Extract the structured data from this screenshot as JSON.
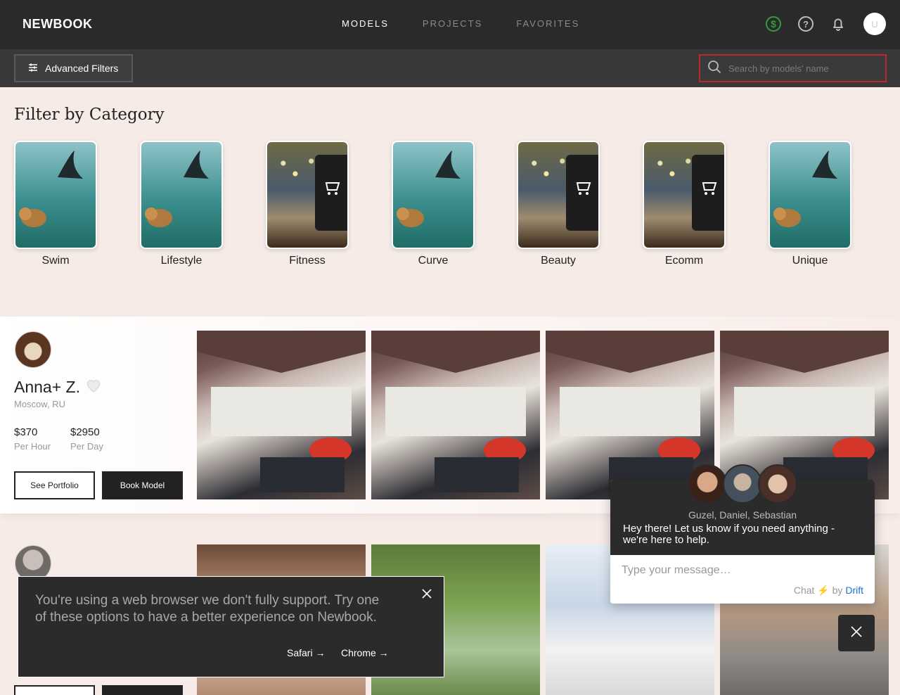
{
  "nav": {
    "logo": "NEWBOOK",
    "tabs": [
      {
        "label": "MODELS",
        "active": true
      },
      {
        "label": "PROJECTS",
        "active": false
      },
      {
        "label": "FAVORITES",
        "active": false
      }
    ],
    "icons": [
      "dollar-icon",
      "help-icon",
      "bell-icon"
    ],
    "avatar_letter": "U"
  },
  "filterbar": {
    "advanced_label": "Advanced Filters",
    "search_placeholder": "Search by models' name"
  },
  "category": {
    "title": "Filter by Category",
    "items": [
      {
        "label": "Swim",
        "image": "sea"
      },
      {
        "label": "Lifestyle",
        "image": "sea"
      },
      {
        "label": "Fitness",
        "image": "store"
      },
      {
        "label": "Curve",
        "image": "sea"
      },
      {
        "label": "Beauty",
        "image": "store"
      },
      {
        "label": "Ecomm",
        "image": "store"
      },
      {
        "label": "Unique",
        "image": "sea"
      }
    ]
  },
  "model": {
    "name": "Anna+ Z.",
    "location": "Moscow, RU",
    "hour_price": "$370",
    "hour_label": "Per Hour",
    "day_price": "$2950",
    "day_label": "Per Day",
    "portfolio_label": "See Portfolio",
    "book_label": "Book Model"
  },
  "banner": {
    "text": "You're using a web browser we don't fully support. Try one of these options to have a better experience on Newbook.",
    "safari": "Safari →",
    "chrome": "Chrome →"
  },
  "chat": {
    "agents": "Guzel, Daniel, Sebastian",
    "message": "Hey there! Let us know if you need anything - we're here to help.",
    "placeholder": "Type your message…",
    "brand_prefix": "Chat ⚡ by ",
    "brand_name": "Drift"
  },
  "colors": {
    "nav_bg": "#2a2a2a",
    "filter_bg": "#383838",
    "page_bg": "#f7ebe7",
    "search_border": "#c0272d",
    "dollar_green": "#2e9e3c",
    "drift_blue": "#1f6fd6"
  }
}
